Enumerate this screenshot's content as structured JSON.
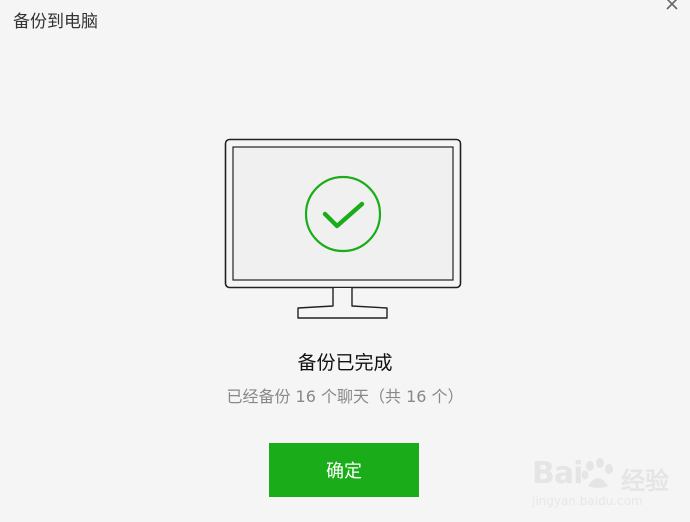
{
  "window": {
    "title": "备份到电脑",
    "close_icon": "close-icon"
  },
  "illustration": {
    "icon": "monitor-icon",
    "status_icon": "check-circle-icon",
    "status_color": "#1aad19"
  },
  "status": {
    "title": "备份已完成",
    "detail": "已经备份 16 个聊天（共 16 个）"
  },
  "actions": {
    "confirm_label": "确定",
    "confirm_color": "#1aad19"
  },
  "watermark": {
    "brand": "Bai",
    "brand_suffix": "经验",
    "url": "jingyan.baidu.com"
  }
}
